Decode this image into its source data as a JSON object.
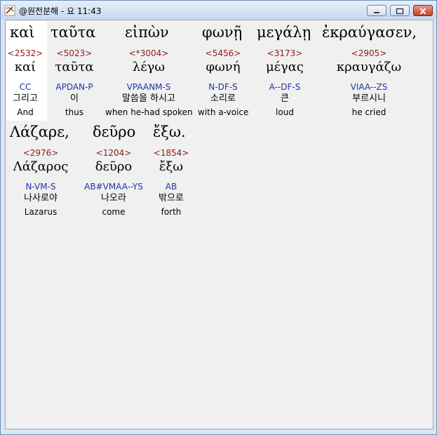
{
  "window": {
    "title": "@원전분해 - 요 11:43"
  },
  "colors": {
    "strongs": "#8b1a1a",
    "parsing": "#2233aa",
    "background": "#f0f0f0"
  },
  "icons": {
    "app": "app-icon",
    "minimize": "minimize-icon",
    "maximize": "maximize-icon",
    "close": "close-icon"
  },
  "words": [
    {
      "greek": "καὶ",
      "strongs": "<2532>",
      "lemma": "καί",
      "parsing": "CC",
      "korean": "그리고",
      "english": "And"
    },
    {
      "greek": "ταῦτα",
      "strongs": "<5023>",
      "lemma": "ταῦτα",
      "parsing": "APDAN-P",
      "korean": "이",
      "english": "thus"
    },
    {
      "greek": "εἰπὼν",
      "strongs": "<*3004>",
      "lemma": "λέγω",
      "parsing": "VPAANM-S",
      "korean": "말씀을 하시고",
      "english": "when he-had spoken"
    },
    {
      "greek": "φωνῇ",
      "strongs": "<5456>",
      "lemma": "φωνή",
      "parsing": "N-DF-S",
      "korean": "소리로",
      "english": "with a-voice"
    },
    {
      "greek": "μεγάλῃ",
      "strongs": "<3173>",
      "lemma": "μέγας",
      "parsing": "A--DF-S",
      "korean": "큰",
      "english": "loud"
    },
    {
      "greek": "ἐκραύγασεν,",
      "strongs": "<2905>",
      "lemma": "κραυγάζω",
      "parsing": "VIAA--ZS",
      "korean": "부르시니",
      "english": "he cried"
    },
    {
      "greek": "Λάζαρε,",
      "strongs": "<2976>",
      "lemma": "Λάζαρος",
      "parsing": "N-VM-S",
      "korean": "나사로야",
      "english": "Lazarus"
    },
    {
      "greek": "δεῦρο",
      "strongs": "<1204>",
      "lemma": "δεῦρο",
      "parsing": "AB#VMAA--YS",
      "korean": "나오라",
      "english": "come"
    },
    {
      "greek": "ἔξω.",
      "strongs": "<1854>",
      "lemma": "ἔξω",
      "parsing": "AB",
      "korean": "밖으로",
      "english": "forth"
    }
  ]
}
